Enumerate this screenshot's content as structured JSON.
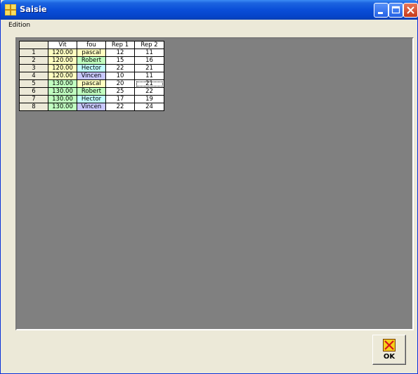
{
  "window": {
    "title": "Saisie"
  },
  "menu": {
    "items": [
      "Edition"
    ]
  },
  "grid": {
    "columns": [
      "Vit",
      "fou",
      "Rep 1",
      "Rep 2"
    ],
    "rows": [
      {
        "num": "1",
        "vit": "120.00",
        "fou": "pascal",
        "rep1": "12",
        "rep2": "11"
      },
      {
        "num": "2",
        "vit": "120.00",
        "fou": "Robert",
        "rep1": "15",
        "rep2": "16"
      },
      {
        "num": "3",
        "vit": "120.00",
        "fou": "Hector",
        "rep1": "22",
        "rep2": "21"
      },
      {
        "num": "4",
        "vit": "120.00",
        "fou": "Vincen",
        "rep1": "10",
        "rep2": "11"
      },
      {
        "num": "5",
        "vit": "130.00",
        "fou": "pascal",
        "rep1": "20",
        "rep2": "21"
      },
      {
        "num": "6",
        "vit": "130.00",
        "fou": "Robert",
        "rep1": "25",
        "rep2": "22"
      },
      {
        "num": "7",
        "vit": "130.00",
        "fou": "Hector",
        "rep1": "17",
        "rep2": "19"
      },
      {
        "num": "8",
        "vit": "130.00",
        "fou": "Vincen",
        "rep1": "22",
        "rep2": "24"
      }
    ],
    "colors": {
      "vit_120": "#FFFFC0",
      "vit_130": "#C0FFC0",
      "fou_pascal": "#FFFFC0",
      "fou_Robert": "#C0FFC0",
      "fou_Hector": "#C0FFFF",
      "fou_Vincen": "#C8C8FF"
    }
  },
  "ok_button": {
    "label": "OK",
    "icon": "cross-box-icon"
  }
}
